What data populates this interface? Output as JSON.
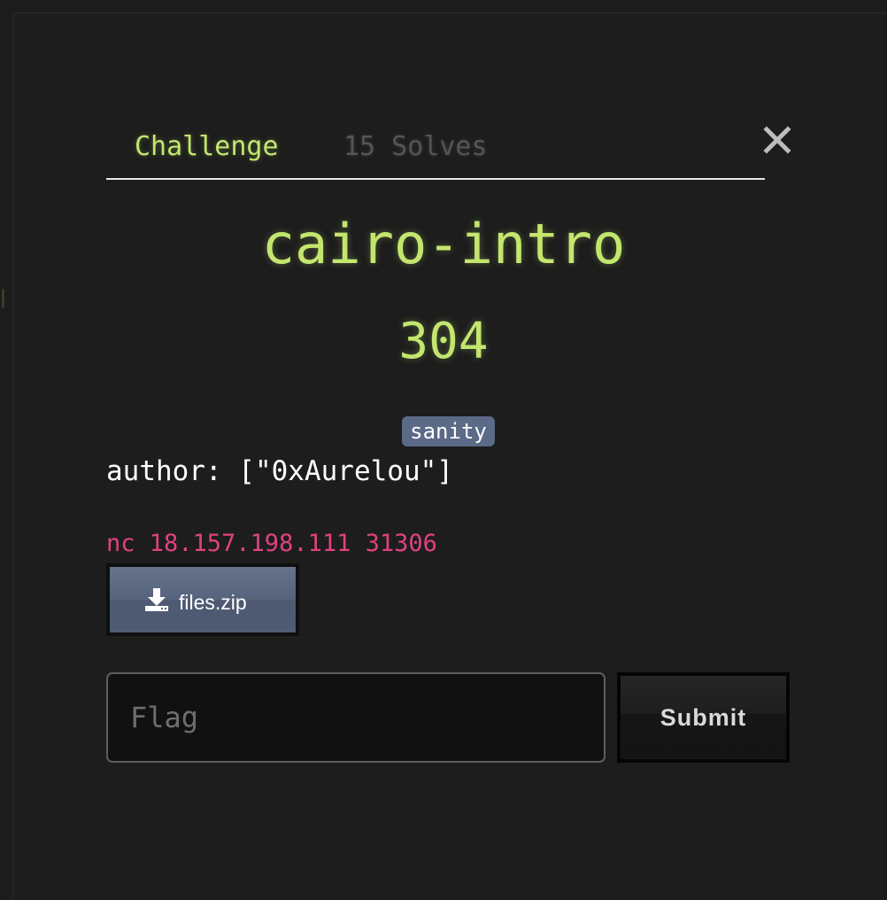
{
  "tabs": [
    {
      "label": "Challenge",
      "active": true
    },
    {
      "label": "15 Solves",
      "active": false
    }
  ],
  "close_icon": "close-icon",
  "challenge": {
    "name": "cairo-intro",
    "points": "304",
    "tag": "sanity",
    "author_line": "author: [\"0xAurelou\"]",
    "connection": "nc 18.157.198.111 31306"
  },
  "file": {
    "icon": "download-icon",
    "label": "files.zip"
  },
  "flag_form": {
    "placeholder": "Flag",
    "value": "",
    "submit_label": "Submit"
  },
  "colors": {
    "accent": "#c3e66e",
    "tag_bg": "#5b6a87",
    "connection_text": "#e0427f",
    "inactive_tab": "#555555"
  }
}
